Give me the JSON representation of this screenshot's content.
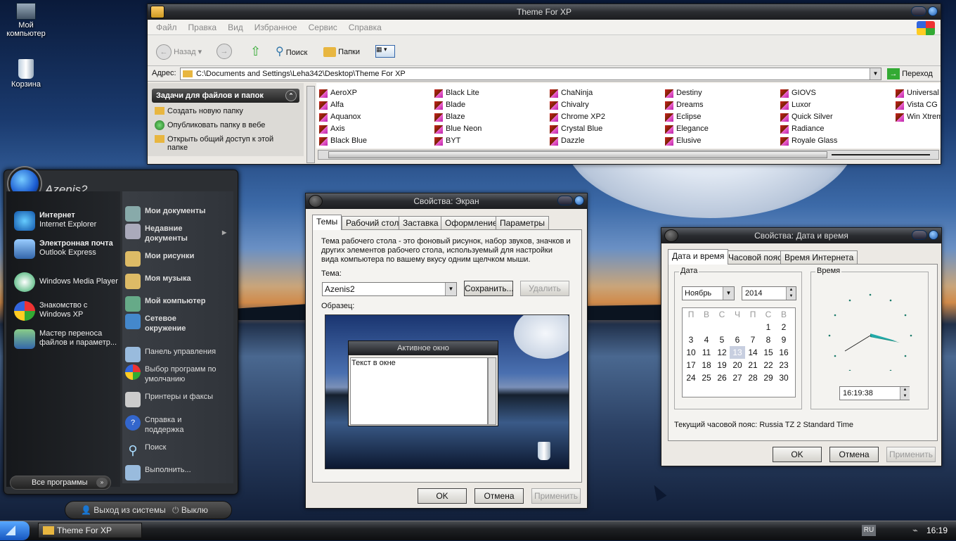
{
  "desktop": {
    "icons": [
      {
        "label": "Мой компьютер"
      },
      {
        "label": "Корзина"
      }
    ]
  },
  "explorer": {
    "title": "Theme For XP",
    "menu": [
      "Файл",
      "Правка",
      "Вид",
      "Избранное",
      "Сервис",
      "Справка"
    ],
    "toolbar": {
      "back": "Назад",
      "search": "Поиск",
      "folders": "Папки"
    },
    "address": {
      "label": "Адрес:",
      "path": "C:\\Documents and Settings\\Leha342\\Desktop\\Theme For XP",
      "go": "Переход"
    },
    "tasks": {
      "header": "Задачи для файлов и папок",
      "items": [
        "Создать новую папку",
        "Опубликовать папку в вебе",
        "Открыть общий доступ к этой папке"
      ]
    },
    "files": [
      [
        "AeroXP",
        "Alfa",
        "Aquanox",
        "Axis",
        "Black Blue"
      ],
      [
        "Black Lite",
        "Blade",
        "Blaze",
        "Blue Neon",
        "BYT"
      ],
      [
        "ChaNinja",
        "Chivalry",
        "Chrome XP2",
        "Crystal Blue",
        "Dazzle"
      ],
      [
        "Destiny",
        "Dreams",
        "Eclipse",
        "Elegance",
        "Elusive"
      ],
      [
        "GIOVS",
        "Luxor",
        "Quick Silver",
        "Radiance",
        "Royale Glass"
      ],
      [
        "Universal",
        "Vista CG",
        "Win Xtrem"
      ]
    ]
  },
  "start_menu": {
    "user": "Azenis2",
    "left": [
      {
        "title": "Интернет",
        "sub": "Internet Explorer"
      },
      {
        "title": "Электронная почта",
        "sub": "Outlook Express"
      },
      {
        "title": "Windows Media Player",
        "sub": ""
      },
      {
        "title": "Знакомство с",
        "sub": "Windows XP"
      },
      {
        "title": "Мастер переноса",
        "sub": "файлов и параметр..."
      }
    ],
    "right": [
      {
        "label": "Мои документы"
      },
      {
        "label": "Недавние документы"
      },
      {
        "label": "Мои рисунки"
      },
      {
        "label": "Моя музыка"
      },
      {
        "label": "Мой компьютер"
      },
      {
        "label": "Сетевое окружение"
      },
      {
        "label": "Панель управления"
      },
      {
        "label": "Выбор программ по умолчанию"
      },
      {
        "label": "Принтеры и факсы"
      },
      {
        "label": "Справка и поддержка"
      },
      {
        "label": "Поиск"
      },
      {
        "label": "Выполнить..."
      }
    ],
    "all_programs": "Все программы",
    "logoff": "Выход из системы",
    "shutdown": "Выклю"
  },
  "display": {
    "title": "Свойства: Экран",
    "tabs": [
      "Темы",
      "Рабочий стол",
      "Заставка",
      "Оформление",
      "Параметры"
    ],
    "description": "Тема рабочего стола - это фоновый рисунок, набор звуков, значков и других элементов рабочего стола, используемый для настройки вида компьютера по вашему вкусу одним щелчком мыши.",
    "theme_label": "Тема:",
    "theme_value": "Azenis2",
    "save": "Сохранить...",
    "delete": "Удалить",
    "sample_label": "Образец:",
    "sample_window_title": "Активное окно",
    "sample_window_text": "Текст в окне",
    "ok": "OK",
    "cancel": "Отмена",
    "apply": "Применить"
  },
  "datetime": {
    "title": "Свойства: Дата и время",
    "tabs": [
      "Дата и время",
      "Часовой пояс",
      "Время Интернета"
    ],
    "date_group": "Дата",
    "time_group": "Время",
    "month": "Ноябрь",
    "year": "2014",
    "weekdays": [
      "П",
      "В",
      "С",
      "Ч",
      "П",
      "С",
      "В"
    ],
    "weeks": [
      [
        "",
        "",
        "",
        "",
        "",
        "1",
        "2"
      ],
      [
        "3",
        "4",
        "5",
        "6",
        "7",
        "8",
        "9"
      ],
      [
        "10",
        "11",
        "12",
        "13",
        "14",
        "15",
        "16"
      ],
      [
        "17",
        "18",
        "19",
        "20",
        "21",
        "22",
        "23"
      ],
      [
        "24",
        "25",
        "26",
        "27",
        "28",
        "29",
        "30"
      ]
    ],
    "selected_day": "13",
    "time": "16:19:38",
    "timezone": "Текущий часовой пояс: Russia TZ 2 Standard Time",
    "ok": "OK",
    "cancel": "Отмена",
    "apply": "Применить"
  },
  "taskbar": {
    "task": "Theme For XP",
    "lang": "RU",
    "clock": "16:19"
  }
}
